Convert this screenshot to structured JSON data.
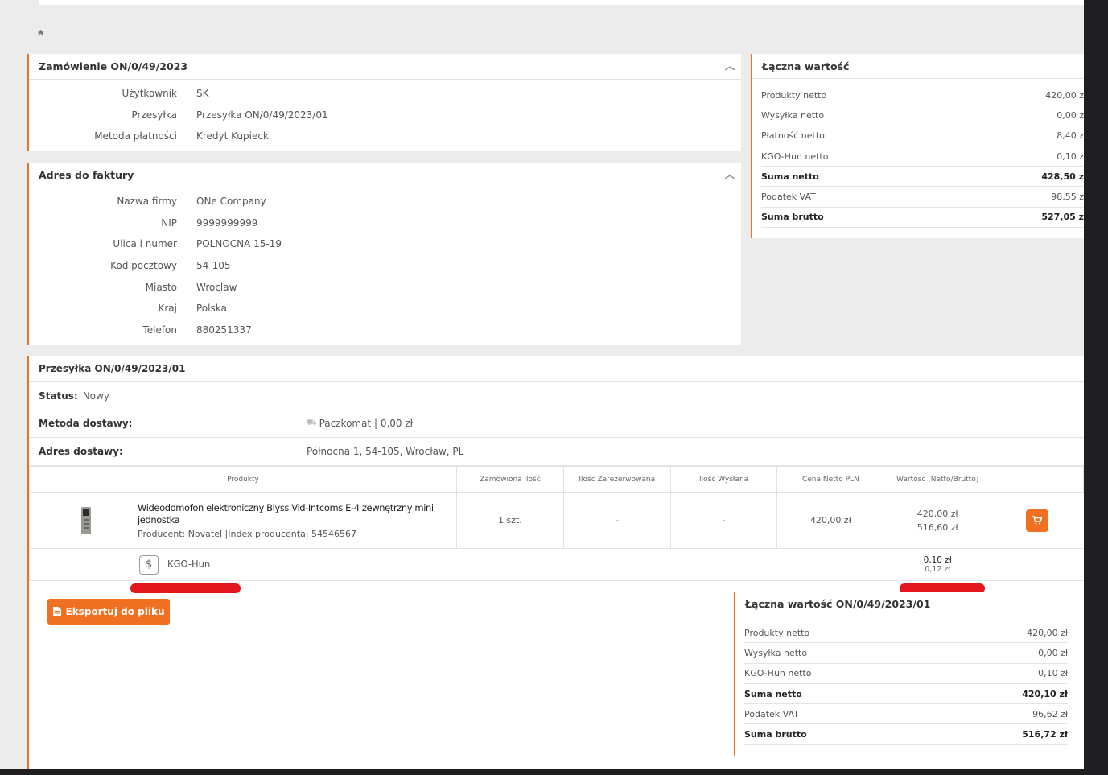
{
  "breadcrumb": {
    "home_icon": "home-icon"
  },
  "order": {
    "title": "Zamówienie ON/0/49/2023",
    "rows": [
      {
        "label": "Użytkownik",
        "value": "SK"
      },
      {
        "label": "Przesyłka",
        "value": "Przesyłka ON/0/49/2023/01"
      },
      {
        "label": "Metoda płatności",
        "value": "Kredyt Kupiecki"
      }
    ]
  },
  "invoice": {
    "title": "Adres do faktury",
    "rows": [
      {
        "label": "Nazwa firmy",
        "value": "ONe Company"
      },
      {
        "label": "NIP",
        "value": "9999999999"
      },
      {
        "label": "Ulica i numer",
        "value": "POLNOCNA 15-19"
      },
      {
        "label": "Kod pocztowy",
        "value": "54-105"
      },
      {
        "label": "Miasto",
        "value": "Wroclaw"
      },
      {
        "label": "Kraj",
        "value": "Polska"
      },
      {
        "label": "Telefon",
        "value": "880251337"
      }
    ]
  },
  "total": {
    "title": "Łączna wartość",
    "rows": [
      {
        "label": "Produkty netto",
        "value": "420,00 z",
        "bold": false
      },
      {
        "label": "Wysyłka netto",
        "value": "0,00 z",
        "bold": false
      },
      {
        "label": "Płatność netto",
        "value": "8,40 z",
        "bold": false
      },
      {
        "label": "KGO-Hun netto",
        "value": "0,10 z",
        "bold": false
      },
      {
        "label": "Suma netto",
        "value": "428,50 z",
        "bold": true
      },
      {
        "label": "Podatek VAT",
        "value": "98,55 z",
        "bold": false
      },
      {
        "label": "Suma brutto",
        "value": "527,05 z",
        "bold": true
      }
    ]
  },
  "shipment": {
    "title": "Przesyłka ON/0/49/2023/01",
    "status_label": "Status:",
    "status_value": "Nowy",
    "method_label": "Metoda dostawy:",
    "method_value": "Paczkomat | 0,00 zł",
    "address_label": "Adres dostawy:",
    "address_value": "Północna 1, 54-105, Wrocław, PL"
  },
  "table": {
    "headers": [
      "Produkty",
      "Zamówiona ilość",
      "Ilość Zarezerwowana",
      "Ilość Wysłana",
      "Cena Netto PLN",
      "Wartość [Netto/Brutto]",
      ""
    ],
    "product": {
      "title": "Wideodomofon elektroniczny Blyss Vid-Intcoms E-4 zewnętrzny mini jednostka",
      "meta": "Producent: Novatel |Index producenta: 54546567",
      "qty": "1 szt.",
      "reserved": "-",
      "sent": "-",
      "price": "420,00 zł",
      "net": "420,00 zł",
      "gross": "516,60 zł"
    },
    "fee": {
      "icon": "dollar-icon",
      "label": "KGO-Hun",
      "net": "0,10 zł",
      "gross": "0,12 zł"
    }
  },
  "export_label": "Eksportuj do pliku",
  "shipment_total": {
    "title": "Łączna wartość ON/0/49/2023/01",
    "rows": [
      {
        "label": "Produkty netto",
        "value": "420,00 zł",
        "bold": false
      },
      {
        "label": "Wysyłka netto",
        "value": "0,00 zł",
        "bold": false
      },
      {
        "label": "KGO-Hun netto",
        "value": "0,10 zł",
        "bold": false
      },
      {
        "label": "Suma netto",
        "value": "420,10 zł",
        "bold": true
      },
      {
        "label": "Podatek VAT",
        "value": "96,62 zł",
        "bold": false
      },
      {
        "label": "Suma brutto",
        "value": "516,72 zł",
        "bold": true
      }
    ]
  },
  "colors": {
    "accent": "#f07021",
    "border": "#e8742a",
    "redaction": "#e3161d"
  }
}
